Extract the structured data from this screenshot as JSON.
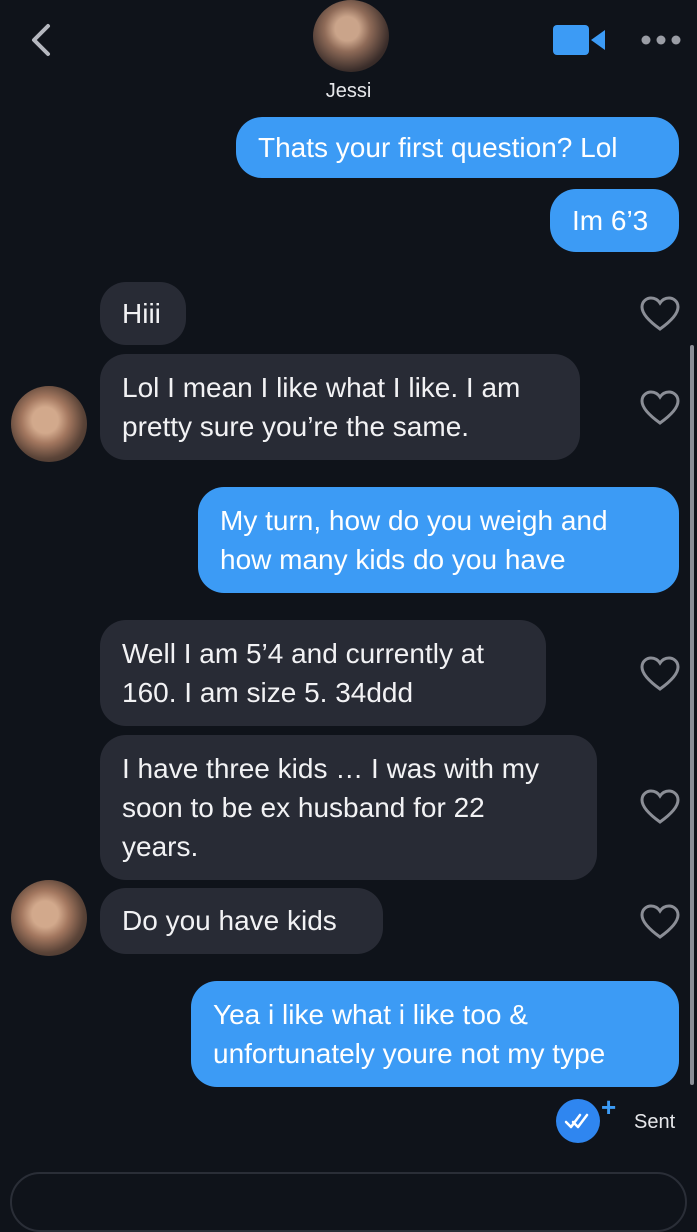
{
  "header": {
    "contact_name": "Jessi",
    "icons": [
      "back-chevron-icon",
      "video-call-icon",
      "more-options-icon"
    ],
    "accent_color": "#3c9bf5"
  },
  "messages": [
    {
      "from": "me",
      "lines": [
        "Thats your first question? Lol"
      ]
    },
    {
      "from": "me",
      "lines": [
        "Im 6’3"
      ]
    },
    {
      "from": "them",
      "lines": [
        "Hiii"
      ]
    },
    {
      "from": "them",
      "lines": [
        "Lol I mean I like what I like. I am",
        "pretty sure you’re the same."
      ]
    },
    {
      "from": "me",
      "lines": [
        "My turn, how do you weigh and",
        "how many kids do you have"
      ]
    },
    {
      "from": "them",
      "lines": [
        "Well I am 5’4 and currently at",
        "160. I am size 5. 34ddd"
      ]
    },
    {
      "from": "them",
      "lines": [
        "I have three kids … I was with my",
        "soon to be ex husband for 22",
        "years."
      ]
    },
    {
      "from": "them",
      "lines": [
        "Do you have kids"
      ]
    },
    {
      "from": "me",
      "lines": [
        "Yea i like what i like too &",
        "unfortunately youre not my type"
      ]
    }
  ],
  "status": {
    "sent_label": "Sent",
    "plus_label": "+"
  },
  "colors": {
    "background": "#0f131a",
    "outgoing_bubble": "#3c9bf5",
    "incoming_bubble": "#282b35"
  }
}
